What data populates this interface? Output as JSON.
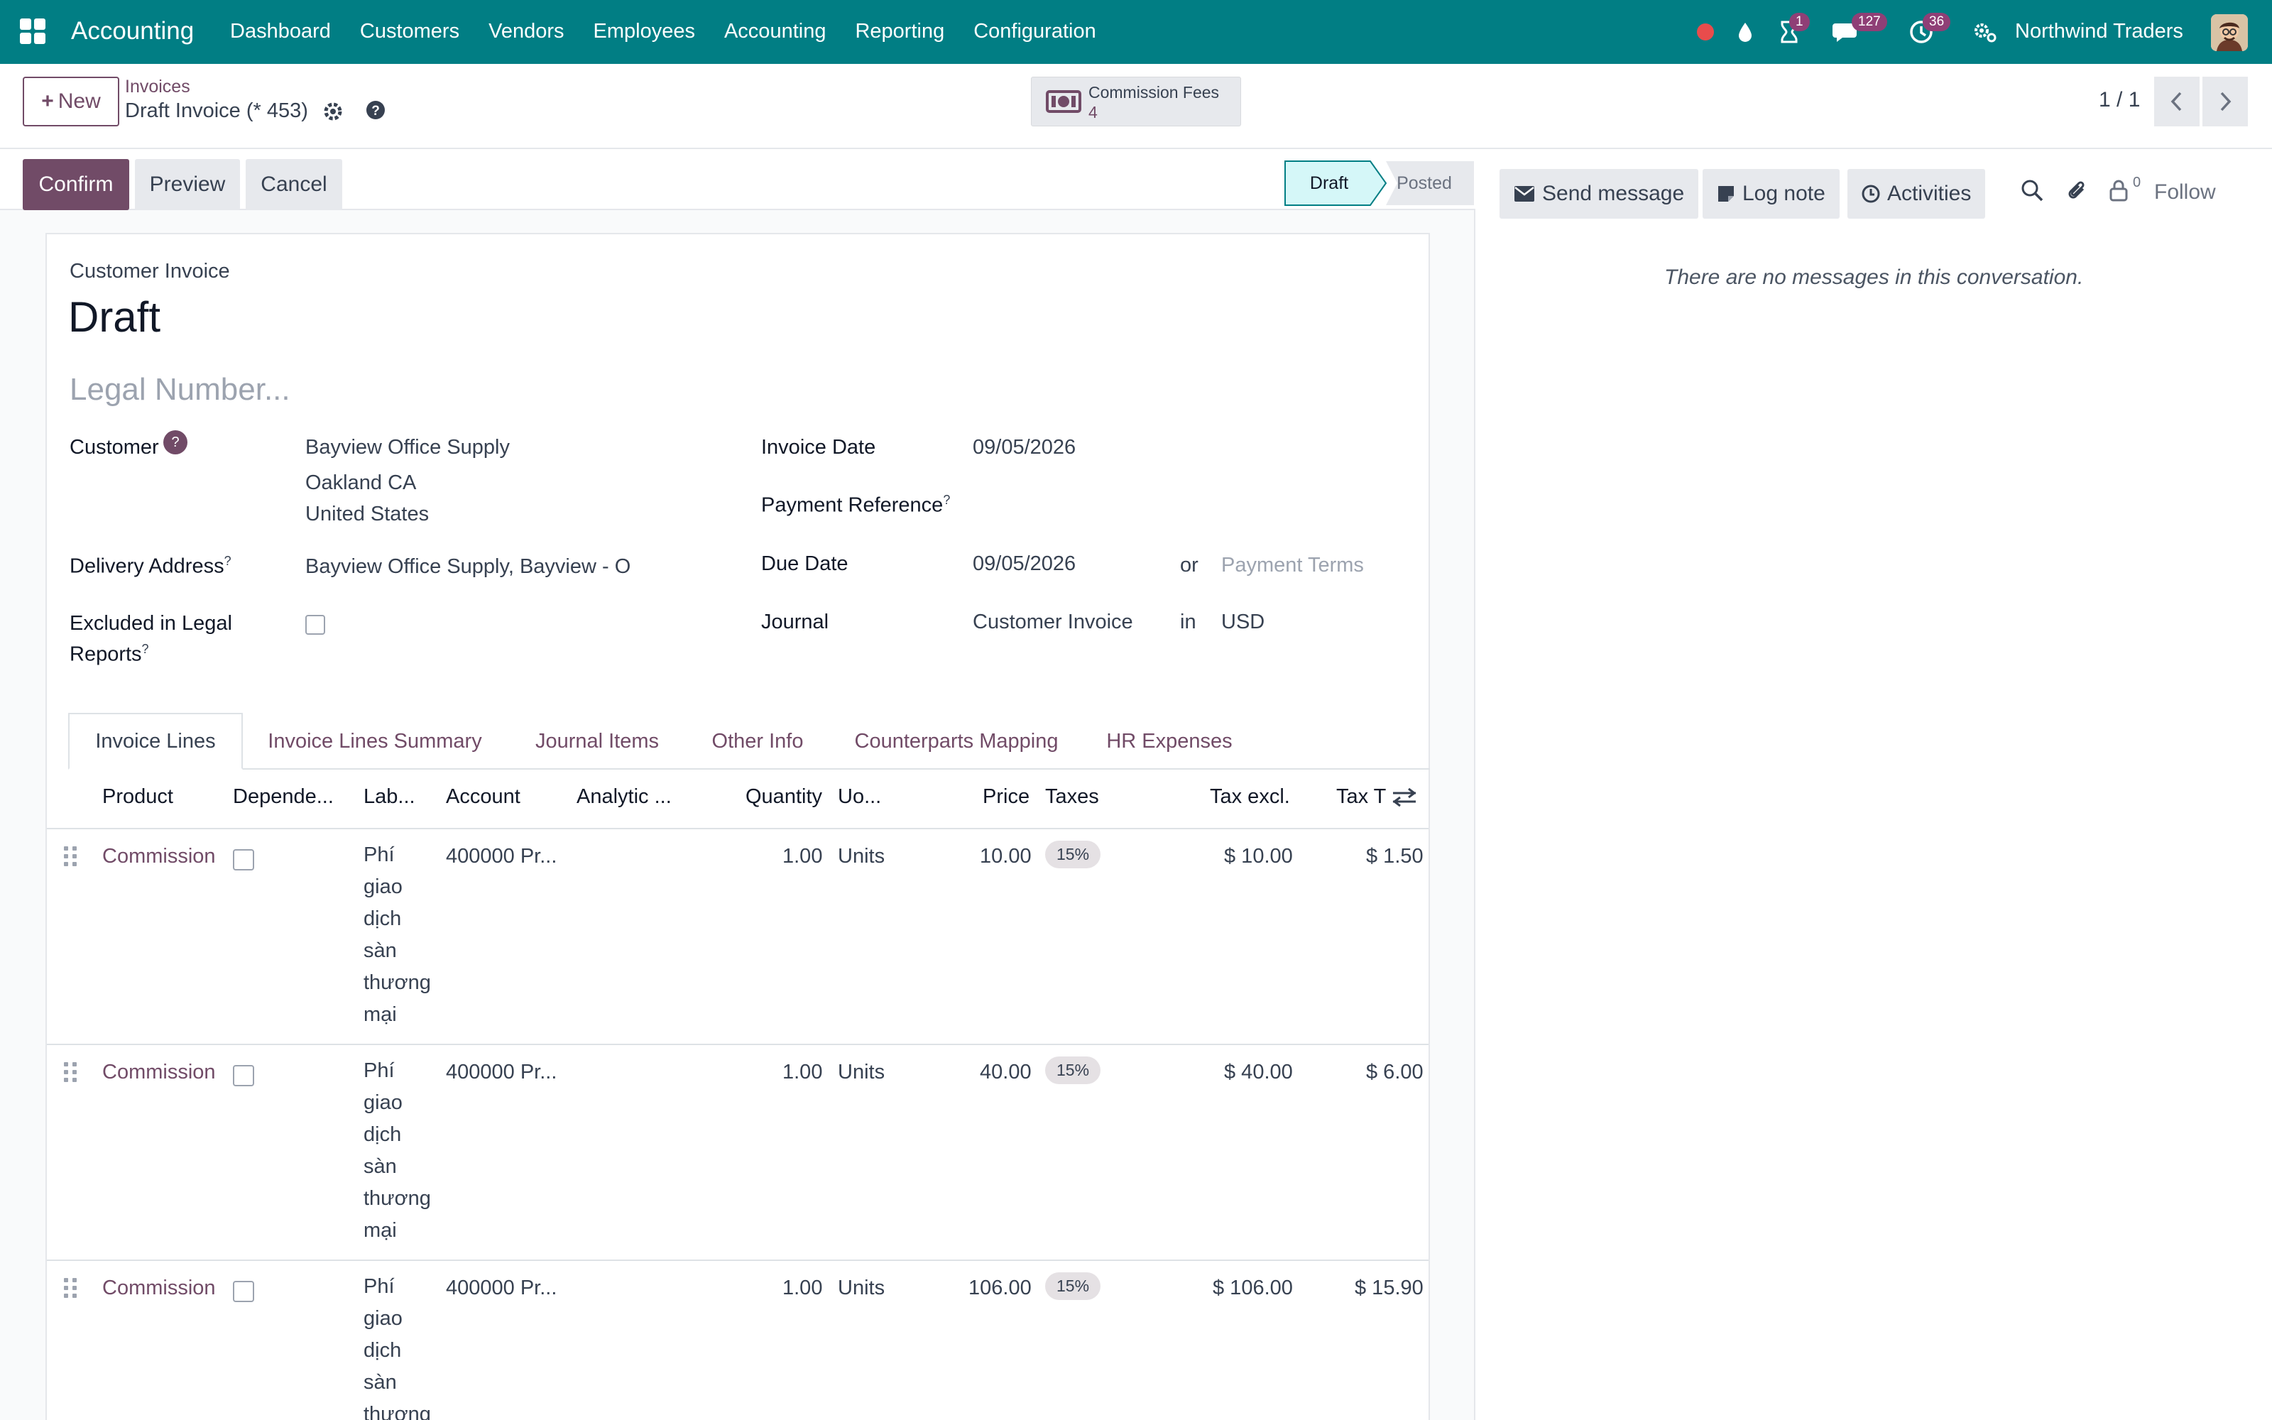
{
  "nav": {
    "brand": "Accounting",
    "menu": [
      "Dashboard",
      "Customers",
      "Vendors",
      "Employees",
      "Accounting",
      "Reporting",
      "Configuration"
    ],
    "badges": {
      "activities": "1",
      "messages": "127",
      "timers": "36"
    },
    "company": "Northwind Traders"
  },
  "control": {
    "new_label": "New",
    "breadcrumb_parent": "Invoices",
    "breadcrumb_current": "Draft Invoice (* 453)",
    "smart_button": {
      "label": "Commission Fees",
      "count": "4"
    },
    "pager": "1 / 1"
  },
  "statusbar": {
    "confirm": "Confirm",
    "preview": "Preview",
    "cancel": "Cancel",
    "stages": [
      "Draft",
      "Posted"
    ],
    "active_stage": "Draft"
  },
  "form": {
    "doc_type": "Customer Invoice",
    "title": "Draft",
    "legal_number_placeholder": "Legal Number...",
    "customer_label": "Customer",
    "customer_name": "Bayview Office Supply",
    "customer_city": "Oakland CA",
    "customer_country": "United States",
    "delivery_label": "Delivery Address",
    "delivery_value": "Bayview Office Supply, Bayview - O",
    "excluded_label_1": "Excluded in Legal",
    "excluded_label_2": "Reports",
    "invoice_date_label": "Invoice Date",
    "invoice_date": "09/05/2026",
    "payment_ref_label": "Payment Reference",
    "due_date_label": "Due Date",
    "due_date": "09/05/2026",
    "or": "or",
    "payment_terms_placeholder": "Payment Terms",
    "journal_label": "Journal",
    "journal": "Customer Invoice",
    "in": "in",
    "currency": "USD",
    "help_mark": "?"
  },
  "tabs": [
    "Invoice Lines",
    "Invoice Lines Summary",
    "Journal Items",
    "Other Info",
    "Counterparts Mapping",
    "HR Expenses"
  ],
  "table": {
    "headers": [
      "Product",
      "Depende...",
      "Lab...",
      "Account",
      "Analytic ...",
      "Quantity",
      "Uo...",
      "Price",
      "Taxes",
      "Tax excl.",
      "Tax T"
    ],
    "rows": [
      {
        "product": "Commission",
        "label": [
          "Phí",
          "giao",
          "dịch",
          "sàn",
          "thương",
          "mại"
        ],
        "account": "400000 Pr...",
        "quantity": "1.00",
        "uom": "Units",
        "price": "10.00",
        "tax": "15%",
        "tax_excl": "$ 10.00",
        "tax_total": "$ 1.50"
      },
      {
        "product": "Commission",
        "label": [
          "Phí",
          "giao",
          "dịch",
          "sàn",
          "thương",
          "mại"
        ],
        "account": "400000 Pr...",
        "quantity": "1.00",
        "uom": "Units",
        "price": "40.00",
        "tax": "15%",
        "tax_excl": "$ 40.00",
        "tax_total": "$ 6.00"
      },
      {
        "product": "Commission",
        "label": [
          "Phí",
          "giao",
          "dịch",
          "sàn",
          "thương"
        ],
        "account": "400000 Pr...",
        "quantity": "1.00",
        "uom": "Units",
        "price": "106.00",
        "tax": "15%",
        "tax_excl": "$ 106.00",
        "tax_total": "$ 15.90"
      }
    ]
  },
  "chatter": {
    "send_message": "Send message",
    "log_note": "Log note",
    "activities": "Activities",
    "followers_count": "0",
    "follow": "Follow",
    "empty": "There are no messages in this conversation."
  },
  "colors": {
    "navbar": "#017e84",
    "primary": "#714b67",
    "stage_active": "#d5f7f8"
  }
}
